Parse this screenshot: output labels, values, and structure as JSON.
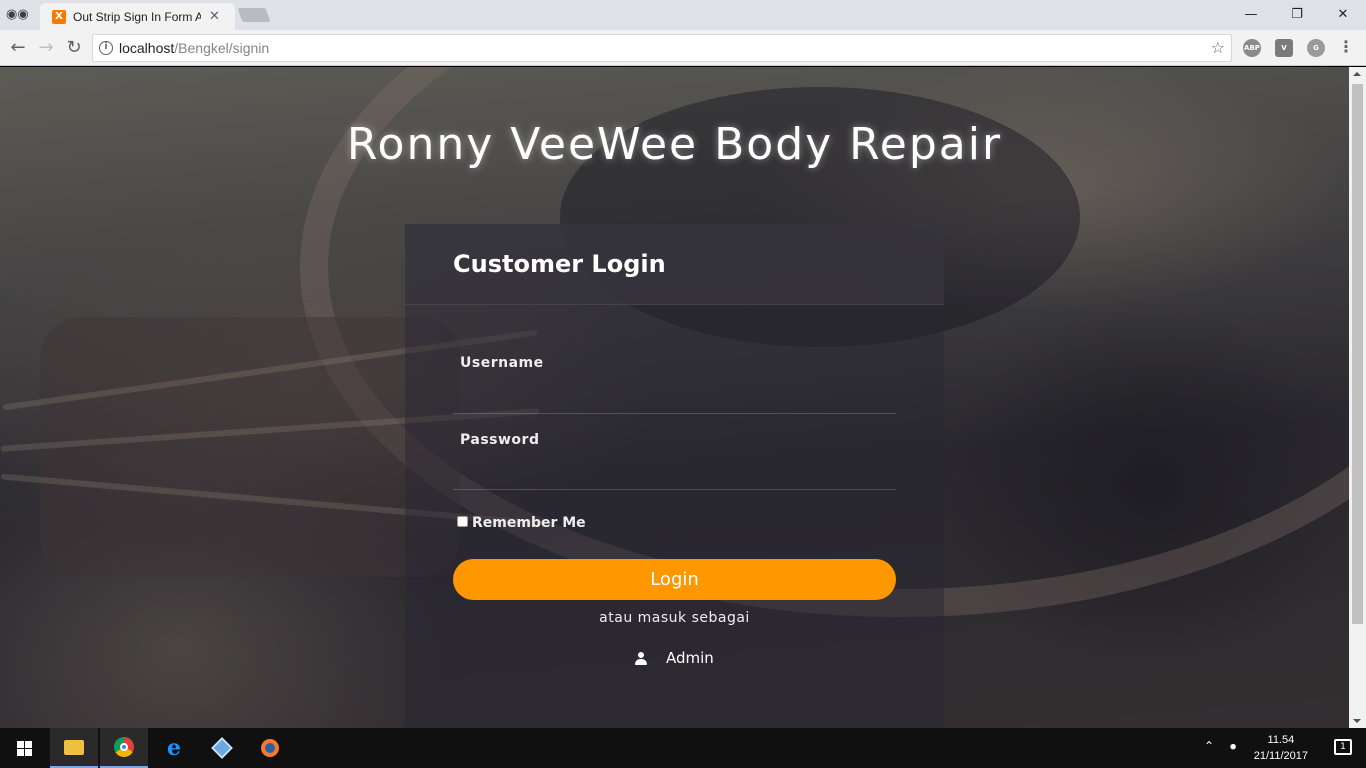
{
  "browser": {
    "tab_title": "Out Strip Sign In Form A",
    "tab_favicon": "X",
    "url_host": "localhost",
    "url_path": "/Bengkel/signin",
    "extensions": [
      "ABP",
      "V",
      "G"
    ]
  },
  "page": {
    "site_title": "Ronny VeeWee Body Repair",
    "login": {
      "heading": "Customer Login",
      "username_label": "Username",
      "username_value": "",
      "password_label": "Password",
      "password_value": "",
      "remember_label": "Remember Me",
      "remember_checked": false,
      "submit_label": "Login",
      "alt_text": "atau masuk sebagai",
      "admin_label": "Admin"
    },
    "accent_color": "#ff9800"
  },
  "taskbar": {
    "time": "11.54",
    "date": "21/11/2017",
    "notification_count": "1",
    "apps": [
      "start-icon",
      "file-explorer-icon",
      "chrome-icon",
      "edge-icon",
      "box-app-icon",
      "blender-icon"
    ]
  }
}
